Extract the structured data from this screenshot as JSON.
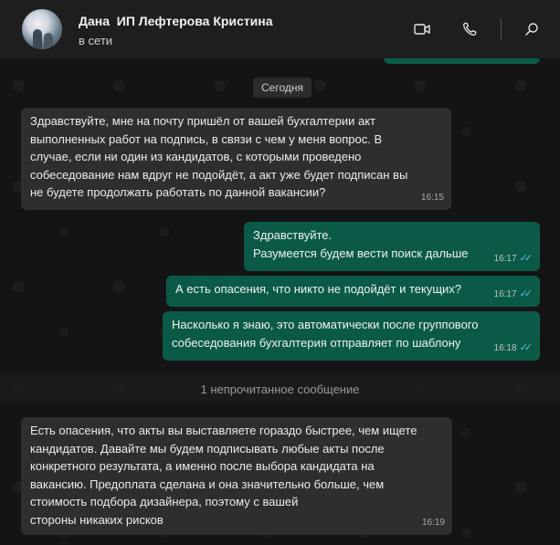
{
  "header": {
    "contact_name": "Дана  ИП Лефтерова Кристина",
    "status": "в сети",
    "icons": [
      "video-call-icon",
      "voice-call-icon",
      "search-icon"
    ]
  },
  "chat": {
    "date_chip": "Сегодня",
    "unread_divider": "1 непрочитанное сообщение",
    "messages": [
      {
        "direction": "in",
        "text": "Здравствуйте, мне на почту пришёл от вашей бухгалтерии акт\nвыполненных работ на подпись, в связи с чем у меня вопрос. В\nслучае, если ни один из кандидатов, с которыми проведено\nсобеседование нам вдруг не подойдёт, а акт уже будет подписан вы\nне будете продолжать работать по данной вакансии?",
        "time": "16:15"
      },
      {
        "direction": "out",
        "text": "Здравствуйте.\nРазумеется будем вести поиск дальше",
        "time": "16:17",
        "status": "read"
      },
      {
        "direction": "out",
        "text": "А есть опасения, что никто не подойдёт и текущих?",
        "time": "16:17",
        "status": "read"
      },
      {
        "direction": "out",
        "text": "Насколько я знаю, это автоматически после группового\nсобеседования бухгалтерия отправляет по шаблону",
        "time": "16:18",
        "status": "read"
      },
      {
        "direction": "in",
        "text": "Есть опасения, что акты вы выставляете гораздо быстрее, чем ищете\nкандидатов. Давайте мы будем подписывать любые акты после\nконкретного результата, а именно после выбора кандидата на\nвакансию. Предоплата сделана и она значительно больше, чем\nстоимость подбора дизайнера, поэтому с вашей\nстороны никаких рисков",
        "time": "16:19"
      }
    ]
  },
  "colors": {
    "header_bg": "#1e1e1e",
    "incoming_bubble": "#2e2e2e",
    "outgoing_bubble": "#0b5a48",
    "read_ticks": "#53bdeb"
  }
}
